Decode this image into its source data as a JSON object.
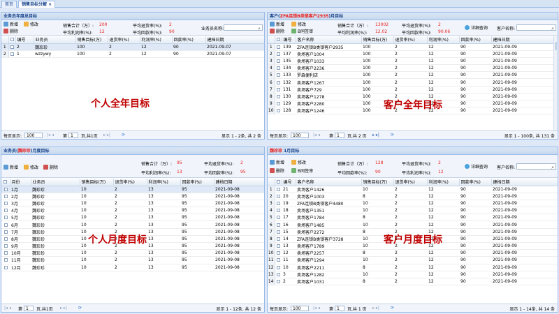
{
  "tabs": [
    {
      "label": "首页"
    },
    {
      "label": "销售目标分解",
      "close": "×"
    }
  ],
  "panel1": {
    "title": "业务员年度总目标",
    "buttons": {
      "add": "新增",
      "edit": "修改",
      "del": "删除"
    },
    "stats": {
      "sales_label": "销售合计（万）:",
      "sales_value": "200",
      "return_label": "平均退货率(%):",
      "return_value": "2",
      "profit_label": "平均利润率(%):",
      "profit_value": "12",
      "collect_label": "平均回款率(%):",
      "collect_value": "90"
    },
    "search_label": "业务员名称:",
    "columns": [
      "",
      "编号",
      "业务员",
      "销售目标(万)",
      "退货率(%)",
      "利润率(%)",
      "回款率(%)",
      "建档日期"
    ],
    "rows": [
      [
        "1",
        "2",
        "魏珍珍",
        "100",
        "2",
        "12",
        "90",
        "2021-09-07"
      ],
      [
        "2",
        "1",
        "wzzywy",
        "100",
        "2",
        "12",
        "90",
        "2021-09-07"
      ]
    ],
    "overlay": "个人全年目标",
    "pager": {
      "per_page_label": "每页显示:",
      "per_page": "100",
      "page_prefix": "第",
      "page": "1",
      "page_suffix": "页,共1页",
      "summary": "显示 1 - 2条, 共 2 条"
    }
  },
  "panel2": {
    "title_prefix": "客户(",
    "title_hl": "ZFA连锁B类锁客户2935",
    "title_suffix": ")月目标",
    "buttons": {
      "add": "新增",
      "edit": "修改",
      "del": "删除",
      "check": "B同签审",
      "query": "详细查询"
    },
    "stats": {
      "sales_label": "销售合计（万）:",
      "sales_value": "13002",
      "return_label": "平均退货率(%):",
      "return_value": "2",
      "profit_label": "平均利润率(%):",
      "profit_value": "12.02",
      "collect_label": "平均回款率(%):",
      "collect_value": "90.06"
    },
    "search_label": "客户名称:",
    "columns": [
      "",
      "编号",
      "客户名称",
      "销售目标(万)",
      "退货率(%)",
      "利润率(%)",
      "回款率(%)",
      "建档日期"
    ],
    "rows": [
      [
        "1",
        "139",
        "ZFA连锁B类锁客户2935",
        "100",
        "2",
        "12",
        "90",
        "2021-09-09"
      ],
      [
        "2",
        "137",
        "卖场客户1004",
        "100",
        "2",
        "12",
        "90",
        "2021-09-09"
      ],
      [
        "3",
        "135",
        "卖场客户1033",
        "100",
        "2",
        "12",
        "90",
        "2021-09-09"
      ],
      [
        "4",
        "134",
        "卖场客户2236",
        "100",
        "2",
        "12",
        "90",
        "2021-09-09"
      ],
      [
        "5",
        "133",
        "罗森便利店",
        "100",
        "2",
        "12",
        "90",
        "2021-09-09"
      ],
      [
        "6",
        "132",
        "卖场客户1267",
        "100",
        "2",
        "12",
        "90",
        "2021-09-09"
      ],
      [
        "7",
        "131",
        "卖场客户729",
        "100",
        "2",
        "12",
        "90",
        "2021-09-09"
      ],
      [
        "8",
        "130",
        "卖场客户1278",
        "100",
        "2",
        "12",
        "90",
        "2021-09-09"
      ],
      [
        "9",
        "129",
        "卖场客户2280",
        "100",
        "2",
        "12",
        "90",
        "2021-09-09"
      ],
      [
        "10",
        "128",
        "卖场客户1246",
        "100",
        "2",
        "12",
        "90",
        "2021-09-09"
      ]
    ],
    "overlay": "客户全年目标",
    "pager": {
      "per_page_label": "每页显示:",
      "per_page": "100",
      "page_prefix": "第",
      "page": "1",
      "page_suffix": "页,共 2 页",
      "summary": "显示 1 - 100条, 共 131 条"
    }
  },
  "panel3": {
    "title_prefix": "业务员(",
    "title_hl": "魏珍珍",
    "title_suffix": ")月度目标",
    "buttons": {
      "add": "新增",
      "edit": "修改",
      "del": "删除"
    },
    "stats": {
      "sales_label": "销售合计（万）:",
      "sales_value": "95",
      "return_label": "平均退货率(%):",
      "return_value": "2",
      "profit_label": "平均利润率(%):",
      "profit_value": "13",
      "collect_label": "平均回款率(%):",
      "collect_value": "95"
    },
    "columns": [
      "",
      "月份",
      "业务员",
      "销售目标(万)",
      "退货率(%)",
      "利润率(%)",
      "回款率(%)",
      "建档日期"
    ],
    "rows": [
      [
        "1月",
        "魏珍珍",
        "10",
        "2",
        "13",
        "95",
        "2021-09-08"
      ],
      [
        "2月",
        "魏珍珍",
        "10",
        "2",
        "13",
        "95",
        "2021-09-08"
      ],
      [
        "3月",
        "魏珍珍",
        "10",
        "2",
        "13",
        "95",
        "2021-09-08"
      ],
      [
        "4月",
        "魏珍珍",
        "10",
        "2",
        "13",
        "95",
        "2021-09-08"
      ],
      [
        "5月",
        "魏珍珍",
        "10",
        "2",
        "13",
        "95",
        "2021-09-08"
      ],
      [
        "6月",
        "魏珍珍",
        "10",
        "2",
        "13",
        "95",
        "2021-09-08"
      ],
      [
        "7月",
        "魏珍珍",
        "10",
        "2",
        "13",
        "95",
        "2021-09-08"
      ],
      [
        "8月",
        "魏珍珍",
        "10",
        "2",
        "13",
        "95",
        "2021-09-08"
      ],
      [
        "9月",
        "魏珍珍",
        "10",
        "2",
        "13",
        "95",
        "2021-09-08"
      ],
      [
        "10月",
        "魏珍珍",
        "10",
        "2",
        "13",
        "95",
        "2021-09-08"
      ],
      [
        "11月",
        "魏珍珍",
        "10",
        "2",
        "13",
        "95",
        "2021-09-08"
      ],
      [
        "12月",
        "魏珍珍",
        "10",
        "2",
        "13",
        "95",
        "2021-09-08"
      ]
    ],
    "overlay": "个人月度目标",
    "pager": {
      "page_prefix": "第",
      "page": "1",
      "page_suffix": "页,共1页",
      "summary": "显示 1 - 12条, 共 12 条"
    }
  },
  "panel4": {
    "title_hl": "魏珍珍",
    "title_suffix": " 1月目标",
    "buttons": {
      "add": "新增",
      "edit": "修改",
      "del": "删除",
      "check": "B同签审",
      "query": "详细查询"
    },
    "stats": {
      "sales_label": "销售合计（万）:",
      "sales_value": "128",
      "return_label": "平均退货率(%):",
      "return_value": "2",
      "profit_label": "平均利润率(%):",
      "profit_value": "12",
      "collect_label": "平均回款率(%):",
      "collect_value": "90"
    },
    "search_label": "客户名称:",
    "columns": [
      "",
      "编号",
      "客户名称",
      "销售目标(万)",
      "退货率(%)",
      "利润率(%)",
      "回款率(%)",
      "建档日期"
    ],
    "rows": [
      [
        "1",
        "21",
        "卖场客户1426",
        "10",
        "2",
        "12",
        "90",
        "2021-09-09"
      ],
      [
        "2",
        "20",
        "卖场客户1003",
        "8",
        "2",
        "12",
        "90",
        "2021-09-09"
      ],
      [
        "3",
        "19",
        "ZFA连锁B类锁客户4480",
        "10",
        "2",
        "12",
        "90",
        "2021-09-09"
      ],
      [
        "4",
        "18",
        "卖场客户1351",
        "10",
        "2",
        "12",
        "90",
        "2021-09-09"
      ],
      [
        "5",
        "17",
        "卖场客户1784",
        "8",
        "2",
        "12",
        "90",
        "2021-09-09"
      ],
      [
        "6",
        "16",
        "卖场客户1485",
        "10",
        "2",
        "12",
        "90",
        "2021-09-09"
      ],
      [
        "7",
        "15",
        "卖场客户2272",
        "8",
        "2",
        "12",
        "90",
        "2021-09-09"
      ],
      [
        "8",
        "14",
        "ZFA连锁B类锁客户3728",
        "10",
        "2",
        "12",
        "90",
        "2021-09-09"
      ],
      [
        "9",
        "13",
        "卖场客户1789",
        "10",
        "2",
        "12",
        "90",
        "2021-09-09"
      ],
      [
        "10",
        "12",
        "卖场客户2257",
        "8",
        "2",
        "12",
        "90",
        "2021-09-09"
      ],
      [
        "11",
        "11",
        "卖场客户1294",
        "10",
        "2",
        "12",
        "90",
        "2021-09-09"
      ],
      [
        "12",
        "10",
        "卖场客户2211",
        "8",
        "2",
        "12",
        "90",
        "2021-09-09"
      ],
      [
        "13",
        "3",
        "卖场客户1282",
        "10",
        "2",
        "12",
        "90",
        "2021-09-09"
      ],
      [
        "14",
        "2",
        "卖场客户1031",
        "8",
        "2",
        "12",
        "90",
        "2021-09-09"
      ]
    ],
    "overlay": "客户月度目标",
    "pager": {
      "per_page_label": "每页显示:",
      "per_page": "100",
      "page_prefix": "第",
      "page": "1",
      "page_suffix": "页,共 1 页",
      "summary": "显示 1 - 14条, 共 14 条"
    }
  }
}
